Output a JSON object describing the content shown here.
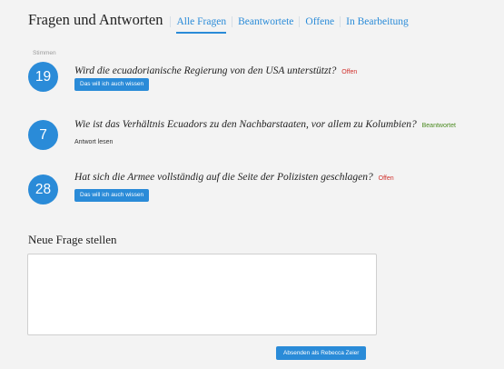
{
  "header": {
    "title": "Fragen und Antworten",
    "tabs": [
      "Alle Fragen",
      "Beantwortete",
      "Offene",
      "In Bearbeitung"
    ]
  },
  "votes_label": "Stimmen",
  "questions": [
    {
      "votes": "19",
      "text": "Wird die ecuadorianische Regierung von den USA unterstützt?",
      "status": "Offen",
      "action": "Das will ich auch wissen"
    },
    {
      "votes": "7",
      "text": "Wie ist das Verhältnis Ecuadors zu den Nachbarstaaten, vor allem zu Kolumbien?",
      "status": "Beantwortet",
      "action": "Antwort lesen"
    },
    {
      "votes": "28",
      "text": "Hat sich die Armee vollständig auf die Seite der Polizisten geschlagen?",
      "status": "Offen",
      "action": "Das will ich auch wissen"
    }
  ],
  "new_question": {
    "title": "Neue Frage stellen",
    "input_value": "",
    "submit_label": "Absenden als Rebecca Zeier"
  },
  "colors": {
    "accent": "#2a8bd8",
    "open": "#d0312d",
    "answered": "#4a8a1f",
    "background": "#f3f3f3"
  }
}
